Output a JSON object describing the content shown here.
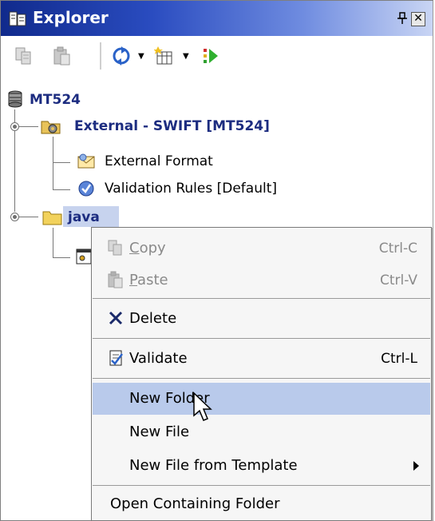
{
  "panel": {
    "title": "Explorer",
    "pin_glyph": "↕",
    "close_glyph": "✕"
  },
  "toolbar": {
    "icons": [
      "copy-icon",
      "paste-icon",
      "sync-icon",
      "new-item-icon",
      "run-icon"
    ]
  },
  "tree": {
    "root": {
      "label": "MT524",
      "icon": "database-icon"
    },
    "nodes": [
      {
        "label": "External - SWIFT [MT524]",
        "icon": "gear-folder-icon"
      },
      {
        "label": "External Format",
        "icon": "envelope-icon"
      },
      {
        "label": "Validation Rules [Default]",
        "icon": "check-circle-icon"
      },
      {
        "label": "java",
        "icon": "folder-icon"
      }
    ]
  },
  "context_menu": {
    "items": [
      {
        "label": "Copy",
        "accelerator": "Ctrl-C",
        "mnemonic": "C",
        "rest": "opy",
        "enabled": false,
        "icon": "copy-icon"
      },
      {
        "label": "Paste",
        "accelerator": "Ctrl-V",
        "mnemonic": "P",
        "rest": "aste",
        "enabled": false,
        "icon": "paste-icon"
      },
      {
        "label": "Delete",
        "accelerator": "",
        "enabled": true,
        "icon": "delete-x-icon"
      },
      {
        "label": "Validate",
        "accelerator": "Ctrl-L",
        "enabled": true,
        "icon": "validate-icon"
      },
      {
        "label": "New Folder",
        "accelerator": "",
        "enabled": true,
        "highlighted": true
      },
      {
        "label": "New File",
        "accelerator": "",
        "enabled": true
      },
      {
        "label": "New File from Template",
        "accelerator": "",
        "enabled": true,
        "submenu": true
      },
      {
        "label": "Open Containing Folder",
        "accelerator": "",
        "enabled": true
      }
    ]
  },
  "colors": {
    "title_bar_start": "#102a8c",
    "tree_bold_text": "#1c2c80",
    "selection": "#c7d3ee",
    "menu_highlight": "#b9caeb"
  }
}
